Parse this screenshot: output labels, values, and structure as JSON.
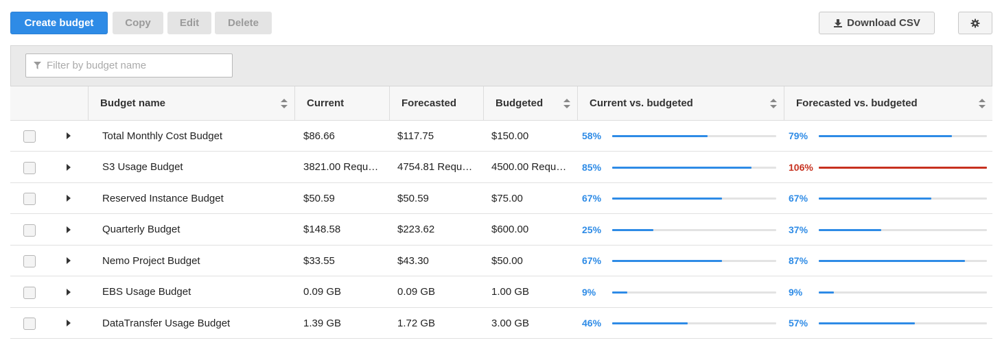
{
  "toolbar": {
    "create_label": "Create budget",
    "copy_label": "Copy",
    "edit_label": "Edit",
    "delete_label": "Delete",
    "download_label": "Download CSV"
  },
  "filter": {
    "placeholder": "Filter by budget name"
  },
  "columns": {
    "name": "Budget name",
    "current": "Current",
    "forecasted": "Forecasted",
    "budgeted": "Budgeted",
    "cur_vs": "Current vs. budgeted",
    "fc_vs": "Forecasted vs. budgeted"
  },
  "colors": {
    "accent": "#2e8be6",
    "over": "#c7311f",
    "track": "#e3e3e3"
  },
  "rows": [
    {
      "name": "Total Monthly Cost Budget",
      "current": "$86.66",
      "forecasted": "$117.75",
      "budgeted": "$150.00",
      "cur_pct": "58%",
      "cur_val": 58,
      "fc_pct": "79%",
      "fc_val": 79
    },
    {
      "name": "S3 Usage Budget",
      "current": "3821.00 Requ…",
      "forecasted": "4754.81 Requ…",
      "budgeted": "4500.00 Requ…",
      "cur_pct": "85%",
      "cur_val": 85,
      "fc_pct": "106%",
      "fc_val": 106
    },
    {
      "name": "Reserved Instance Budget",
      "current": "$50.59",
      "forecasted": "$50.59",
      "budgeted": "$75.00",
      "cur_pct": "67%",
      "cur_val": 67,
      "fc_pct": "67%",
      "fc_val": 67
    },
    {
      "name": "Quarterly Budget",
      "current": "$148.58",
      "forecasted": "$223.62",
      "budgeted": "$600.00",
      "cur_pct": "25%",
      "cur_val": 25,
      "fc_pct": "37%",
      "fc_val": 37
    },
    {
      "name": "Nemo Project Budget",
      "current": "$33.55",
      "forecasted": "$43.30",
      "budgeted": "$50.00",
      "cur_pct": "67%",
      "cur_val": 67,
      "fc_pct": "87%",
      "fc_val": 87
    },
    {
      "name": "EBS Usage Budget",
      "current": "0.09 GB",
      "forecasted": "0.09 GB",
      "budgeted": "1.00 GB",
      "cur_pct": "9%",
      "cur_val": 9,
      "fc_pct": "9%",
      "fc_val": 9
    },
    {
      "name": "DataTransfer Usage Budget",
      "current": "1.39 GB",
      "forecasted": "1.72 GB",
      "budgeted": "3.00 GB",
      "cur_pct": "46%",
      "cur_val": 46,
      "fc_pct": "57%",
      "fc_val": 57
    }
  ]
}
